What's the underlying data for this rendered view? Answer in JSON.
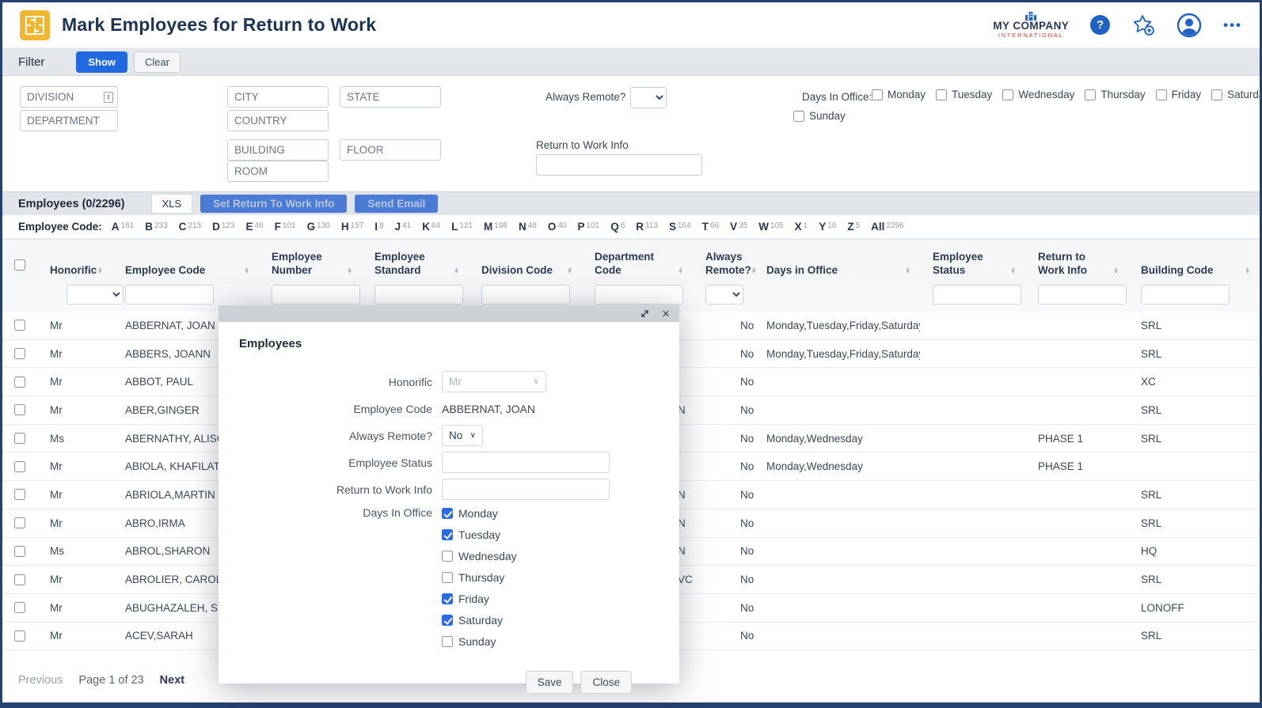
{
  "header": {
    "title": "Mark Employees for Return to Work",
    "logo_line1": "MY COMPANY",
    "logo_line2": "INTERNATIONAL",
    "help_glyph": "?",
    "ellipsis_glyph": "•••"
  },
  "filter_bar": {
    "label": "Filter",
    "show_button": "Show",
    "clear_button": "Clear"
  },
  "filters": {
    "division_placeholder": "DIVISION",
    "department_placeholder": "DEPARTMENT",
    "city_placeholder": "CITY",
    "state_placeholder": "STATE",
    "country_placeholder": "COUNTRY",
    "building_placeholder": "BUILDING",
    "floor_placeholder": "FLOOR",
    "room_placeholder": "ROOM",
    "always_remote_label": "Always Remote?",
    "days_in_office_label": "Days In Office:",
    "days_row1": [
      "Monday",
      "Tuesday",
      "Wednesday",
      "Thursday",
      "Friday",
      "Saturday"
    ],
    "days_row2": [
      "Sunday"
    ],
    "return_to_work_label": "Return to Work Info"
  },
  "section": {
    "title": "Employees (0/2296)",
    "xls_button": "XLS",
    "set_rtw_button": "Set Return To Work Info",
    "send_email_button": "Send Email"
  },
  "employee_code_index": {
    "label": "Employee Code:",
    "items": [
      {
        "letter": "A",
        "count": "161"
      },
      {
        "letter": "B",
        "count": "233"
      },
      {
        "letter": "C",
        "count": "213"
      },
      {
        "letter": "D",
        "count": "123"
      },
      {
        "letter": "E",
        "count": "46"
      },
      {
        "letter": "F",
        "count": "101"
      },
      {
        "letter": "G",
        "count": "130"
      },
      {
        "letter": "H",
        "count": "157"
      },
      {
        "letter": "I",
        "count": "8"
      },
      {
        "letter": "J",
        "count": "41"
      },
      {
        "letter": "K",
        "count": "64"
      },
      {
        "letter": "L",
        "count": "121"
      },
      {
        "letter": "M",
        "count": "198"
      },
      {
        "letter": "N",
        "count": "48"
      },
      {
        "letter": "O",
        "count": "40"
      },
      {
        "letter": "P",
        "count": "101"
      },
      {
        "letter": "Q",
        "count": "6"
      },
      {
        "letter": "R",
        "count": "113"
      },
      {
        "letter": "S",
        "count": "164"
      },
      {
        "letter": "T",
        "count": "66"
      },
      {
        "letter": "V",
        "count": "35"
      },
      {
        "letter": "W",
        "count": "105"
      },
      {
        "letter": "X",
        "count": "1"
      },
      {
        "letter": "Y",
        "count": "16"
      },
      {
        "letter": "Z",
        "count": "5"
      },
      {
        "letter": "All",
        "count": "2296"
      }
    ]
  },
  "table": {
    "columns": [
      "",
      "Honorific",
      "Employee Code",
      "Employee Number",
      "Employee Standard",
      "Division Code",
      "Department Code",
      "Always Remote?",
      "Days in Office",
      "Employee Status",
      "Return to Work Info",
      "Building Code"
    ],
    "filter_controls": [
      "none",
      "select",
      "input",
      "input",
      "input",
      "input",
      "input",
      "select",
      "none",
      "input",
      "input",
      "input"
    ],
    "rows": [
      {
        "honorific": "Mr",
        "employee_code": "ABBERNAT, JOAN",
        "department_fragment": "",
        "always_remote": "No",
        "days_in_office": "Monday,Tuesday,Friday,Saturday",
        "employee_status": "",
        "return_to_work_info": "",
        "building_code": "SRL"
      },
      {
        "honorific": "Mr",
        "employee_code": "ABBERS, JOANN",
        "department_fragment": "",
        "always_remote": "No",
        "days_in_office": "Monday,Tuesday,Friday,Saturday",
        "employee_status": "",
        "return_to_work_info": "",
        "building_code": "SRL"
      },
      {
        "honorific": "Mr",
        "employee_code": "ABBOT, PAUL",
        "department_fragment": "",
        "always_remote": "No",
        "days_in_office": "",
        "employee_status": "",
        "return_to_work_info": "",
        "building_code": "XC"
      },
      {
        "honorific": "Mr",
        "employee_code": "ABER,GINGER",
        "department_fragment": "N",
        "always_remote": "No",
        "days_in_office": "",
        "employee_status": "",
        "return_to_work_info": "",
        "building_code": "SRL"
      },
      {
        "honorific": "Ms",
        "employee_code": "ABERNATHY, ALISON",
        "department_fragment": "",
        "always_remote": "No",
        "days_in_office": "Monday,Wednesday",
        "employee_status": "",
        "return_to_work_info": "PHASE 1",
        "building_code": "SRL"
      },
      {
        "honorific": "Mr",
        "employee_code": "ABIOLA, KHAFILAT",
        "department_fragment": "",
        "always_remote": "No",
        "days_in_office": "Monday,Wednesday",
        "employee_status": "",
        "return_to_work_info": "PHASE 1",
        "building_code": ""
      },
      {
        "honorific": "Mr",
        "employee_code": "ABRIOLA,MARTIN",
        "department_fragment": "N",
        "always_remote": "No",
        "days_in_office": "",
        "employee_status": "",
        "return_to_work_info": "",
        "building_code": "SRL"
      },
      {
        "honorific": "Mr",
        "employee_code": "ABRO,IRMA",
        "department_fragment": "N",
        "always_remote": "No",
        "days_in_office": "",
        "employee_status": "",
        "return_to_work_info": "",
        "building_code": "SRL"
      },
      {
        "honorific": "Ms",
        "employee_code": "ABROL,SHARON",
        "department_fragment": "N",
        "always_remote": "No",
        "days_in_office": "",
        "employee_status": "",
        "return_to_work_info": "",
        "building_code": "HQ"
      },
      {
        "honorific": "Mr",
        "employee_code": "ABROLIER, CAROLE",
        "department_fragment": "VCS",
        "always_remote": "No",
        "days_in_office": "",
        "employee_status": "",
        "return_to_work_info": "",
        "building_code": "SRL"
      },
      {
        "honorific": "Mr",
        "employee_code": "ABUGHAZALEH, SHA",
        "department_fragment": "",
        "always_remote": "No",
        "days_in_office": "",
        "employee_status": "",
        "return_to_work_info": "",
        "building_code": "LONOFF"
      },
      {
        "honorific": "Mr",
        "employee_code": "ACEV,SARAH",
        "department_fragment": "",
        "always_remote": "No",
        "days_in_office": "",
        "employee_status": "",
        "return_to_work_info": "",
        "building_code": "SRL"
      }
    ]
  },
  "pagination": {
    "previous": "Previous",
    "current": "Page 1 of 23",
    "next": "Next"
  },
  "modal": {
    "title": "Employees",
    "honorific_label": "Honorific",
    "honorific_value": "Mr",
    "employee_code_label": "Employee Code",
    "employee_code_value": "ABBERNAT, JOAN",
    "always_remote_label": "Always Remote?",
    "always_remote_value": "No",
    "employee_status_label": "Employee Status",
    "employee_status_value": "",
    "return_to_work_label": "Return to Work Info",
    "return_to_work_value": "",
    "days_label": "Days In Office",
    "days": [
      {
        "label": "Monday",
        "checked": true
      },
      {
        "label": "Tuesday",
        "checked": true
      },
      {
        "label": "Wednesday",
        "checked": false
      },
      {
        "label": "Thursday",
        "checked": false
      },
      {
        "label": "Friday",
        "checked": true
      },
      {
        "label": "Saturday",
        "checked": true
      },
      {
        "label": "Sunday",
        "checked": false
      }
    ],
    "save_button": "Save",
    "close_button": "Close"
  },
  "colors": {
    "accent_blue": "#2069e0",
    "navy_title": "#1c3353",
    "disabled_button_blue": "#4a7cd6",
    "logo_red": "#d04038",
    "icon_blue": "#1d62c4",
    "checkbox_checked_blue": "#2b6be4"
  }
}
